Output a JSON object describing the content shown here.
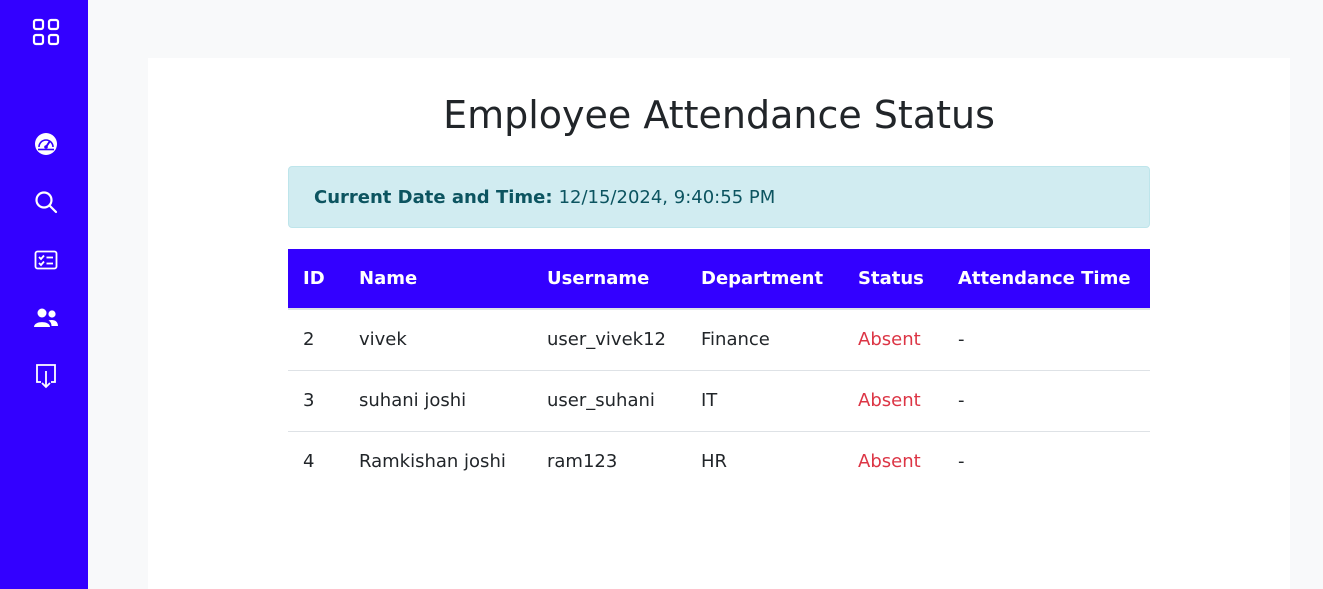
{
  "sidebar": {
    "items": [
      {
        "icon": "grid-icon",
        "name": "menu"
      },
      {
        "icon": "dashboard-icon",
        "name": "dashboard"
      },
      {
        "icon": "search-icon",
        "name": "search"
      },
      {
        "icon": "checklist-icon",
        "name": "attendance"
      },
      {
        "icon": "people-icon",
        "name": "employees"
      },
      {
        "icon": "download-icon",
        "name": "download"
      }
    ]
  },
  "main": {
    "title": "Employee Attendance Status",
    "datetime_label": "Current Date and Time:",
    "datetime_value": "12/15/2024, 9:40:55 PM"
  },
  "table": {
    "headers": [
      "ID",
      "Name",
      "Username",
      "Department",
      "Status",
      "Attendance Time"
    ],
    "rows": [
      {
        "id": "2",
        "name": "vivek",
        "username": "user_vivek12",
        "department": "Finance",
        "status": "Absent",
        "time": "-"
      },
      {
        "id": "3",
        "name": "suhani joshi",
        "username": "user_suhani",
        "department": "IT",
        "status": "Absent",
        "time": "-"
      },
      {
        "id": "4",
        "name": "Ramkishan joshi",
        "username": "ram123",
        "department": "HR",
        "status": "Absent",
        "time": "-"
      }
    ]
  },
  "colors": {
    "sidebar": "#3300ff",
    "table_header": "#3300ff",
    "absent": "#dc3545",
    "alert_bg": "#d1ecf1"
  }
}
